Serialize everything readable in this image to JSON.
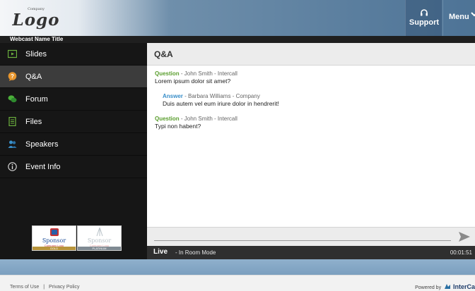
{
  "header": {
    "logo_small": "Company",
    "logo_text": "Logo",
    "support_label": "Support",
    "menu_label": "Menu",
    "colors": {
      "accent": "#4d7396"
    }
  },
  "title_bar": {
    "title": "Webcast Name Title"
  },
  "sidebar": {
    "items": [
      {
        "label": "Slides",
        "icon": "slides-icon",
        "active": false
      },
      {
        "label": "Q&A",
        "icon": "qa-bubble-icon",
        "active": true
      },
      {
        "label": "Forum",
        "icon": "forum-icon",
        "active": false
      },
      {
        "label": "Files",
        "icon": "files-icon",
        "active": false
      },
      {
        "label": "Speakers",
        "icon": "speakers-icon",
        "active": false
      },
      {
        "label": "Event Info",
        "icon": "info-icon",
        "active": false
      }
    ],
    "sponsors": [
      {
        "label": "Sponsor",
        "sub": "Company Logo",
        "tier": "GOLD",
        "tier_color": "#b8943a"
      },
      {
        "label": "Sponsor",
        "sub": "Company Logo",
        "tier": "PLATINUM",
        "tier_color": "#7f8a92"
      }
    ]
  },
  "main": {
    "panel_title": "Q&A",
    "messages": [
      {
        "role": "Question",
        "author": " - John Smith - Intercall",
        "text": "Lorem ipsum dolor sit amet?"
      },
      {
        "role": "Answer",
        "author": " - Barbara Williams - Company",
        "text": "Duis autem vel eum iriure dolor in hendrerit!"
      },
      {
        "role": "Question",
        "author": " - John Smith - Intercall",
        "text": "Typi non habent?"
      }
    ],
    "live_label": "Live",
    "live_mode": " - In Room Mode",
    "elapsed": "00:01:51"
  },
  "footer": {
    "terms": "Terms of Use",
    "separator": "|",
    "privacy": "Privacy Policy",
    "powered_by": "Powered by",
    "brand": "InterCa"
  }
}
